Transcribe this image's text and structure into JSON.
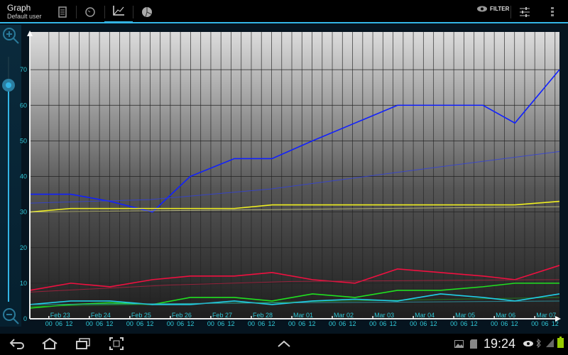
{
  "header": {
    "title": "Graph",
    "subtitle": "Default user",
    "filter_label": "FILTER",
    "tabs": [
      {
        "icon": "list-icon"
      },
      {
        "icon": "gauge-icon"
      },
      {
        "icon": "graph-icon",
        "selected": true
      },
      {
        "icon": "pie-chart-icon"
      }
    ]
  },
  "status": {
    "time": "19:24"
  },
  "chart_data": {
    "type": "line",
    "ylim": [
      0,
      80.6
    ],
    "xlim": [
      -0.47,
      12.61
    ],
    "yticks": [
      0,
      10,
      20,
      30,
      40,
      50,
      60,
      70
    ],
    "x_day_labels": [
      "Feb 23",
      "Feb 24",
      "Feb 25",
      "Feb 26",
      "Feb 27",
      "Feb 28",
      "Mar 01",
      "Mar 02",
      "Mar 03",
      "Mar 04",
      "Mar 05",
      "Mar 06",
      "Mar 07"
    ],
    "x_hour_labels": [
      "00",
      "06",
      "12"
    ],
    "grid": true,
    "series": [
      {
        "name": "blue",
        "color": "#1020ff",
        "x": [
          -0.47,
          0.54,
          1.51,
          2.56,
          3.49,
          4.58,
          5.51,
          6.51,
          7.56,
          8.61,
          9.67,
          10.72,
          11.51,
          12.61
        ],
        "y": [
          35,
          35,
          33,
          30,
          40,
          45,
          45,
          50,
          55,
          60,
          60,
          60,
          55,
          70
        ]
      },
      {
        "name": "blue-trend",
        "color": "#3040e0",
        "trend": true,
        "x": [
          -0.47,
          2.5,
          5.5,
          8.5,
          12.61
        ],
        "y": [
          32.5,
          33.5,
          36.5,
          41,
          47
        ]
      },
      {
        "name": "yellow",
        "color": "#f0f020",
        "x": [
          -0.47,
          0.54,
          1.51,
          2.56,
          3.49,
          4.58,
          5.51,
          6.51,
          7.56,
          8.61,
          9.67,
          10.72,
          11.51,
          12.61
        ],
        "y": [
          30,
          31,
          31,
          31,
          31,
          31,
          32,
          32,
          32,
          32,
          32,
          32,
          32,
          33
        ]
      },
      {
        "name": "yellow-trend",
        "color": "#c8c880",
        "trend": true,
        "x": [
          -0.47,
          12.61
        ],
        "y": [
          30,
          31.5
        ]
      },
      {
        "name": "red",
        "color": "#f01040",
        "x": [
          -0.47,
          0.54,
          1.51,
          2.56,
          3.49,
          4.58,
          5.51,
          6.51,
          7.56,
          8.61,
          9.67,
          10.72,
          11.51,
          12.61
        ],
        "y": [
          8,
          10,
          9,
          11,
          12,
          12,
          13,
          11,
          10,
          14,
          13,
          12,
          11,
          15
        ]
      },
      {
        "name": "red-trend",
        "color": "#b02040",
        "trend": true,
        "x": [
          -0.47,
          3,
          6,
          12.61
        ],
        "y": [
          7.5,
          9.5,
          10.5,
          11
        ]
      },
      {
        "name": "green",
        "color": "#20e020",
        "x": [
          -0.47,
          0.54,
          1.51,
          2.56,
          3.49,
          4.58,
          5.51,
          6.51,
          7.56,
          8.61,
          9.67,
          10.72,
          11.51,
          12.61
        ],
        "y": [
          3,
          4,
          4.5,
          4,
          6,
          6,
          5,
          7,
          6,
          8,
          8,
          9,
          10,
          10
        ]
      },
      {
        "name": "green-trend",
        "color": "#209020",
        "trend": true,
        "x": [
          -0.47,
          12.61
        ],
        "y": [
          3.5,
          6
        ]
      },
      {
        "name": "cyan",
        "color": "#20d0e8",
        "x": [
          -0.47,
          0.54,
          1.51,
          2.56,
          3.49,
          4.58,
          5.51,
          6.51,
          7.56,
          8.61,
          9.67,
          10.72,
          11.51,
          12.61
        ],
        "y": [
          4,
          5,
          5,
          4,
          4,
          5,
          4,
          5,
          5.5,
          5,
          7,
          6,
          5,
          7
        ]
      },
      {
        "name": "cyan-trend",
        "color": "#30a0b0",
        "trend": true,
        "x": [
          -0.47,
          12.61
        ],
        "y": [
          4,
          5
        ]
      }
    ]
  }
}
